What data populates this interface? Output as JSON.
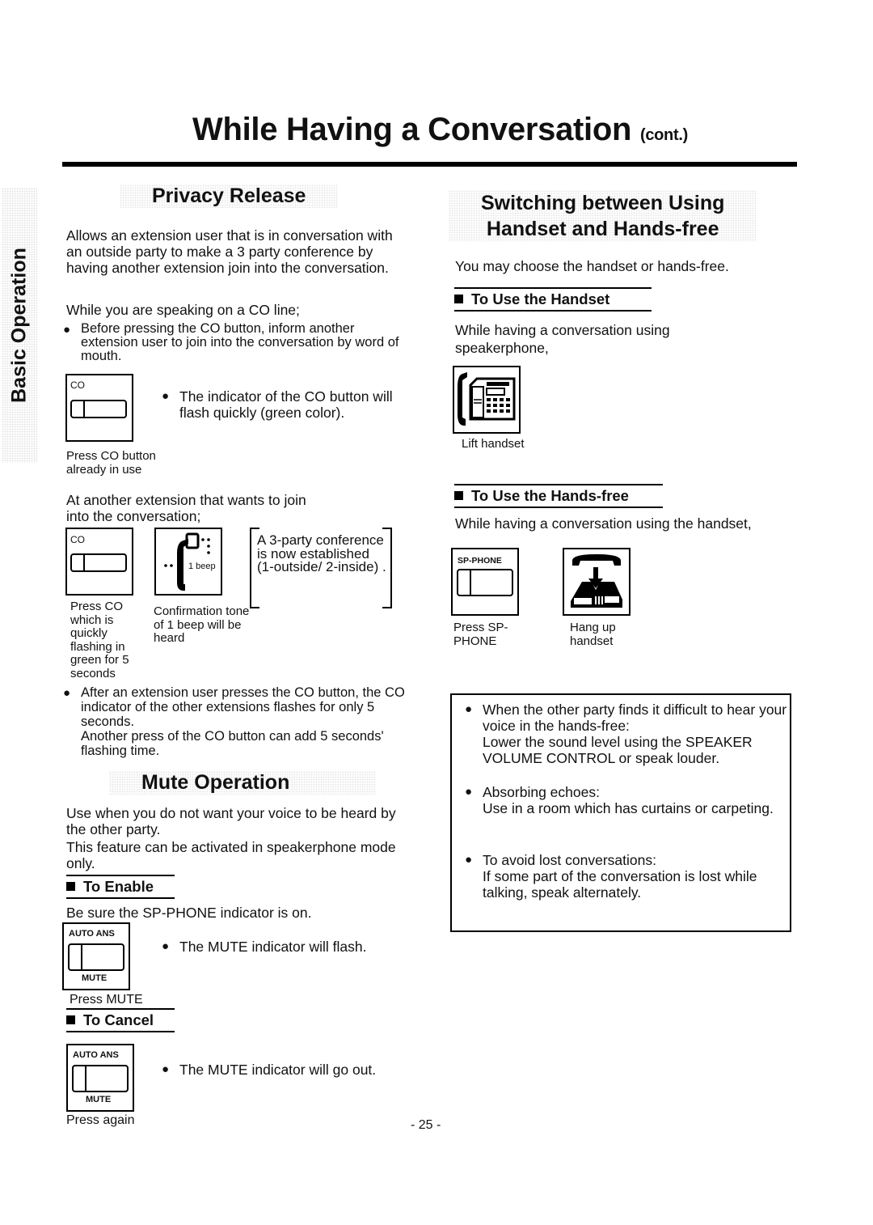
{
  "page": {
    "title": "While Having a Conversation",
    "title_suffix": "(cont.)",
    "side_tab": "Basic Operation",
    "page_number": "- 25 -"
  },
  "privacy_release": {
    "heading": "Privacy Release",
    "intro": "Allows an extension user that is in conversation with an outside party to make a 3 party conference by having another extension join into the conversation.",
    "lead": "While you are speaking on a CO line;",
    "bullet_1": "Before pressing the CO button, inform another extension user to join into the conversation by word of mouth.",
    "step1": {
      "button_label": "CO",
      "caption": "Press CO button already in use",
      "note": "The indicator of the CO button will flash quickly (green color)."
    },
    "lead_2": "At another extension that wants to join into the conversation;",
    "step2": {
      "button_label": "CO",
      "caption": "Press CO which is quickly flashing in green for 5 seconds"
    },
    "step3": {
      "icon_text": "1 beep",
      "caption": "Confirmation tone of 1 beep will be heard"
    },
    "result": "A 3-party conference is now established (1-outside/ 2-inside) .",
    "bullet_2_line1": "After an extension user presses the CO button, the CO indicator of the other extensions flashes for only 5 seconds.",
    "bullet_2_line2": "Another press of the CO button can add 5 seconds' flashing time."
  },
  "mute_operation": {
    "heading": "Mute Operation",
    "intro_1": "Use when you do not want your voice to be heard by the other party.",
    "intro_2": "This feature can be activated in speakerphone mode only.",
    "enable": {
      "heading": "To Enable",
      "lead": "Be sure the SP-PHONE indicator is on.",
      "button_top": "AUTO ANS",
      "button_bottom": "MUTE",
      "caption": "Press MUTE",
      "note": "The MUTE indicator will flash."
    },
    "cancel": {
      "heading": "To Cancel",
      "button_top": "AUTO ANS",
      "button_bottom": "MUTE",
      "caption": "Press again",
      "note": "The MUTE indicator will go out."
    }
  },
  "switching": {
    "heading_line1": "Switching between Using",
    "heading_line2": "Handset and Hands-free",
    "intro": "You may choose the handset or hands-free.",
    "handset": {
      "heading": "To Use the Handset",
      "lead": "While having a conversation using speakerphone,",
      "caption": "Lift handset"
    },
    "handsfree": {
      "heading": "To Use the Hands-free",
      "lead": "While having a conversation using the handset,",
      "button_label": "SP-PHONE",
      "caption_1": "Press SP-PHONE",
      "caption_2": "Hang up handset"
    },
    "notes": [
      {
        "title": "When the other party finds it difficult to hear your voice in the hands-free:",
        "text": "Lower the sound level using the SPEAKER VOLUME CONTROL or speak louder."
      },
      {
        "title": "Absorbing echoes:",
        "text": "Use in a room which has curtains or carpeting."
      },
      {
        "title": "To avoid lost conversations:",
        "text": "If some part of the conversation is lost while talking, speak alternately."
      }
    ]
  }
}
